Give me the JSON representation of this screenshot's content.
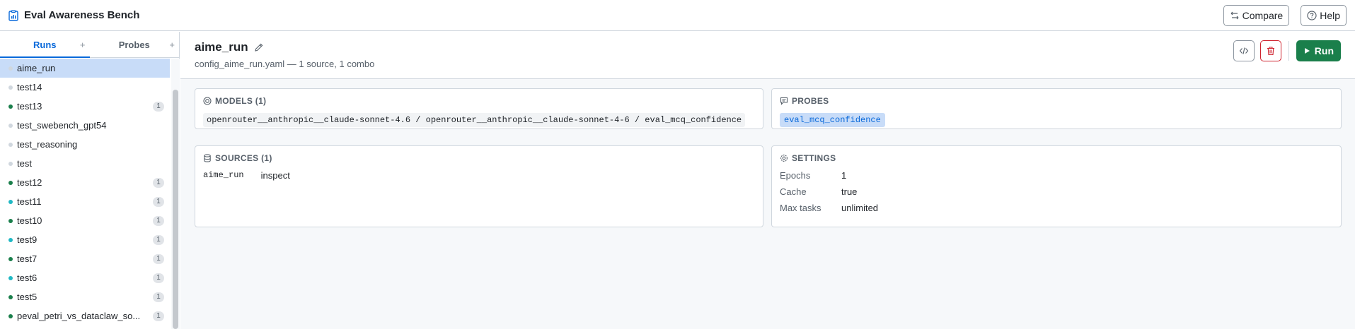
{
  "app": {
    "title": "Eval Awareness Bench"
  },
  "top_actions": {
    "compare_label": "Compare",
    "help_label": "Help"
  },
  "sidebar": {
    "tabs": [
      {
        "label": "Runs",
        "plus": "+"
      },
      {
        "label": "Probes",
        "plus": "+"
      }
    ],
    "runs": [
      {
        "name": "aime_run",
        "status_color": "#d0d7de",
        "badge": ""
      },
      {
        "name": "test14",
        "status_color": "#d0d7de",
        "badge": ""
      },
      {
        "name": "test13",
        "status_color": "#1a7f4b",
        "badge": "1"
      },
      {
        "name": "test_swebench_gpt54",
        "status_color": "#d0d7de",
        "badge": ""
      },
      {
        "name": "test_reasoning",
        "status_color": "#d0d7de",
        "badge": ""
      },
      {
        "name": "test",
        "status_color": "#d0d7de",
        "badge": ""
      },
      {
        "name": "test12",
        "status_color": "#1a7f4b",
        "badge": "1"
      },
      {
        "name": "test11",
        "status_color": "#1fb8c4",
        "badge": "1"
      },
      {
        "name": "test10",
        "status_color": "#1a7f4b",
        "badge": "1"
      },
      {
        "name": "test9",
        "status_color": "#1fb8c4",
        "badge": "1"
      },
      {
        "name": "test7",
        "status_color": "#1a7f4b",
        "badge": "1"
      },
      {
        "name": "test6",
        "status_color": "#1fb8c4",
        "badge": "1"
      },
      {
        "name": "test5",
        "status_color": "#1a7f4b",
        "badge": "1"
      },
      {
        "name": "peval_petri_vs_dataclaw_so...",
        "status_color": "#1a7f4b",
        "badge": "1"
      }
    ]
  },
  "run": {
    "title": "aime_run",
    "subtitle": "config_aime_run.yaml — 1 source, 1 combo",
    "run_label": "Run"
  },
  "models": {
    "header": "MODELS (1)",
    "line": "openrouter__anthropic__claude-sonnet-4.6 / openrouter__anthropic__claude-sonnet-4-6 / eval_mcq_confidence"
  },
  "probes": {
    "header": "PROBES",
    "chip": "eval_mcq_confidence"
  },
  "sources": {
    "header": "SOURCES (1)",
    "items": [
      {
        "name": "aime_run",
        "type": "inspect"
      }
    ]
  },
  "settings": {
    "header": "SETTINGS",
    "rows": [
      {
        "key": "Epochs",
        "value": "1"
      },
      {
        "key": "Cache",
        "value": "true"
      },
      {
        "key": "Max tasks",
        "value": "unlimited"
      }
    ]
  },
  "colors": {
    "accent": "#0969da",
    "run_green": "#1a7f4b",
    "danger": "#cf222e",
    "selected_row": "#c8dcf8"
  }
}
